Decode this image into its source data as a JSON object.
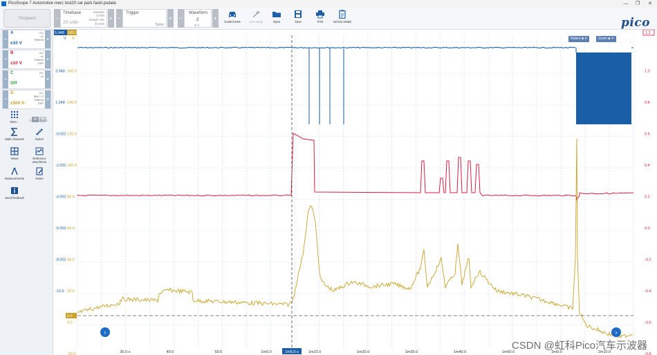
{
  "window": {
    "title": "PicoScope 7 Automotive merc test20 car park faukt.psdata",
    "controls": [
      "—",
      "❐",
      "✕"
    ]
  },
  "toolbar": {
    "run_button": "Stopped",
    "timebase": {
      "label": "Timebase",
      "value": "20 s/div",
      "samples_label": "Samples",
      "samples_value": "10 MS",
      "rate_label": "Sample rate",
      "rate_value": "20 kS/s"
    },
    "trigger": {
      "label": "Trigger",
      "mode": "None"
    },
    "waveform": {
      "label": "Waveform",
      "current": "2",
      "of": "of 2"
    },
    "tools": [
      {
        "label": "Guided tests",
        "icon": "car-icon",
        "enabled": true
      },
      {
        "label": "Auto setup",
        "icon": "wand-icon",
        "enabled": false
      },
      {
        "label": "Open",
        "icon": "folder-icon",
        "enabled": true
      },
      {
        "label": "Save",
        "icon": "save-icon",
        "enabled": true
      },
      {
        "label": "Print",
        "icon": "print-icon",
        "enabled": true
      },
      {
        "label": "Vehicle details",
        "icon": "clipboard-icon",
        "enabled": true
      }
    ],
    "logo_text": "pico",
    "logo_sub": "Technology"
  },
  "channels": [
    {
      "letter": "A",
      "meta": "DC\nx1\nFiltered",
      "range": "±10 V",
      "color": "#1a5ea8",
      "enabled": true
    },
    {
      "letter": "B",
      "meta": "DC\nx1\nFiltered\nDSP",
      "range": "±10 V",
      "color": "#d81c3f",
      "enabled": true
    },
    {
      "letter": "C",
      "meta": "DC\nx1",
      "range": "Off",
      "color": "#2e9e3e",
      "enabled": false
    },
    {
      "letter": "D",
      "meta": "DC\nBNC+ 2\nFiltered\nDSP",
      "range": "±500 A",
      "color": "#c9a227",
      "enabled": true
    }
  ],
  "sidebar": {
    "ab": [
      "A",
      "B"
    ],
    "connect_direct": "ConnectDirect",
    "tools": [
      {
        "label": "More...",
        "icon": "grid-icon"
      },
      {
        "label": "Math channels",
        "icon": "sigma-icon"
      },
      {
        "label": "Rulers",
        "icon": "ruler-icon"
      },
      {
        "label": "Views",
        "icon": "views-icon"
      },
      {
        "label": "Reference waveforms",
        "icon": "reference-icon"
      },
      {
        "label": "Measurements",
        "icon": "measure-icon"
      },
      {
        "label": "Notes",
        "icon": "notes-icon"
      },
      {
        "label": "Send feedback",
        "icon": "feedback-icon"
      }
    ]
  },
  "scope": {
    "rulers_pill": "Rulers",
    "zoom_pill": "Zoom",
    "left_axis_top_labels": [
      "5.948",
      "180.0"
    ],
    "left_axis_top_units": [
      "V",
      "A"
    ],
    "left_axis_blue": [
      "3.948",
      "1.948",
      "-0.052",
      "-2.052",
      "-4.052",
      "-6.052",
      "-8.052",
      "-10.0"
    ],
    "left_axis_gold": [
      "160.0",
      "140.0",
      "120.0",
      "100.0",
      "80.0",
      "60.0",
      "40.0",
      "20.0",
      "0.0",
      "-20.0"
    ],
    "right_axis": [
      "1.0",
      "0.8",
      "0.6",
      "0.4",
      "0.2",
      "0.0",
      "-0.2",
      "-0.4",
      "-0.6",
      "-0.8"
    ],
    "right_axis_tag": "1.2",
    "x_axis": [
      "30.0 s",
      "40.0",
      "50.0",
      "1m0.0",
      "1m5.0 s",
      "1m10.0",
      "1m20.0",
      "1m30.0",
      "1m40.0",
      "1m50.0",
      "2m0.0",
      "2m10.0"
    ],
    "x_axis_highlight": "1m5.0 s",
    "ref_left": "0.0"
  },
  "colors": {
    "channel_a": "#1a5ea8",
    "channel_b": "#d81c3f",
    "channel_d": "#c9a227",
    "grid": "#c9d9ea"
  },
  "watermark": "CSDN @虹科Pico汽车示波器"
}
